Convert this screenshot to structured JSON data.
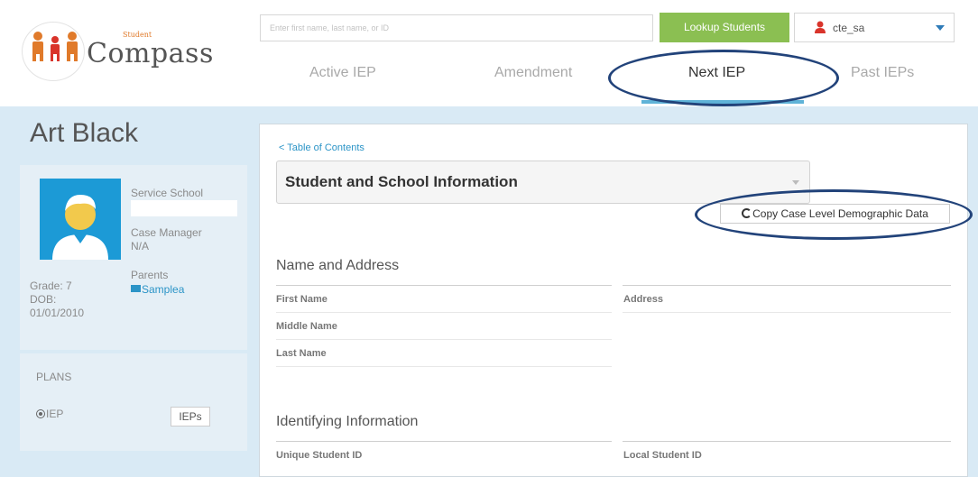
{
  "logo": {
    "small_text": "Student",
    "word": "Compass"
  },
  "search": {
    "placeholder": "Enter first name, last name, or ID"
  },
  "lookup": {
    "label": "Lookup Students"
  },
  "user": {
    "name": "cte_sa"
  },
  "tabs": [
    {
      "label": "Active IEP"
    },
    {
      "label": "Amendment"
    },
    {
      "label": "Next IEP"
    },
    {
      "label": "Past IEPs"
    }
  ],
  "student": {
    "name": "Art Black",
    "service_school_label": "Service School",
    "case_manager_label": "Case Manager",
    "case_manager_value": "N/A",
    "parents_label": "Parents",
    "parent_name": "Samplea",
    "grade": "Grade: 7",
    "dob_label": "DOB:",
    "dob_value": "01/01/2010"
  },
  "plans": {
    "heading": "PLANS",
    "iep_label": "IEP",
    "ieps_button": "IEPs"
  },
  "main": {
    "toc_link": "< Table of Contents",
    "section_title": "Student and School Information",
    "copy_button": "Copy Case Level Demographic Data",
    "name_address": {
      "heading": "Name and Address",
      "first_name": "First Name",
      "middle_name": "Middle Name",
      "last_name": "Last Name",
      "address": "Address"
    },
    "identifying": {
      "heading": "Identifying Information",
      "unique_id": "Unique Student ID",
      "local_id": "Local Student ID"
    }
  },
  "colors": {
    "accent": "#2b94c7",
    "lookup": "#8bbf52",
    "avatar_bg": "#1c9ad6",
    "annotation_oval": "#22437a"
  }
}
